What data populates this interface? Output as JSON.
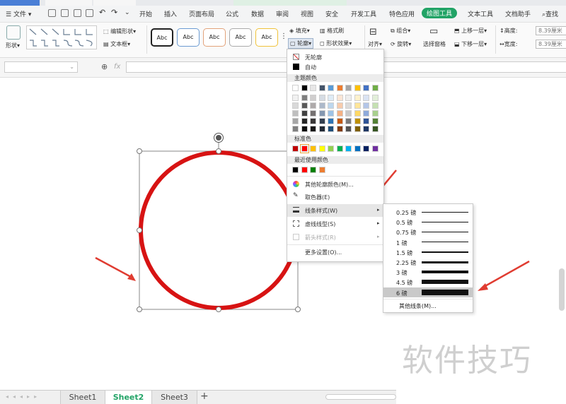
{
  "menu": {
    "file": "文件",
    "tabs": [
      "开始",
      "插入",
      "页面布局",
      "公式",
      "数据",
      "审阅",
      "视图",
      "安全",
      "开发工具",
      "特色应用",
      "绘图工具",
      "文本工具",
      "文档助手"
    ],
    "active_tab": "绘图工具",
    "search": "查找"
  },
  "ribbon": {
    "shape_label": "形状",
    "edit_shape": "编辑形状",
    "text_box": "文本框",
    "style_samples": [
      "Abc",
      "Abc",
      "Abc",
      "Abc",
      "Abc"
    ],
    "fill": "填充",
    "outline": "轮廓",
    "format_brush": "格式刷",
    "shape_effect": "形状效果",
    "align": "对齐",
    "group": "组合",
    "rotate": "旋转",
    "selection_pane": "选择窗格",
    "bring_forward": "上移一层",
    "send_backward": "下移一层",
    "height_label": "高度:",
    "width_label": "宽度:",
    "height_value": "8.39厘米",
    "width_value": "8.39厘米"
  },
  "formula": {
    "fx": "fx"
  },
  "outline_menu": {
    "no_outline": "无轮廓",
    "auto": "自动",
    "theme_colors_title": "主题颜色",
    "theme_top_row": [
      "#ffffff",
      "#000000",
      "#e7e6e6",
      "#44546a",
      "#5b9bd5",
      "#ed7d31",
      "#a5a5a5",
      "#ffc000",
      "#4472c4",
      "#70ad47"
    ],
    "theme_tint_columns": [
      [
        "#f2f2f2",
        "#d9d9d9",
        "#bfbfbf",
        "#a6a6a6",
        "#808080"
      ],
      [
        "#7f7f7f",
        "#595959",
        "#404040",
        "#262626",
        "#0d0d0d"
      ],
      [
        "#d0cece",
        "#aeaaaa",
        "#757171",
        "#3a3838",
        "#171616"
      ],
      [
        "#d6dce4",
        "#adb9ca",
        "#8497b0",
        "#333f4f",
        "#222a35"
      ],
      [
        "#deebf6",
        "#bdd7ee",
        "#9dc3e6",
        "#2e75b5",
        "#1f4e79"
      ],
      [
        "#fbe5d5",
        "#f7cbac",
        "#f4b183",
        "#c55a11",
        "#833c0b"
      ],
      [
        "#ededed",
        "#dbdbdb",
        "#c9c9c9",
        "#7b7b7b",
        "#525252"
      ],
      [
        "#fff2cc",
        "#fee599",
        "#ffd965",
        "#bf9000",
        "#7f6000"
      ],
      [
        "#dae3f3",
        "#b4c6e7",
        "#8eaadb",
        "#2f5496",
        "#1f3864"
      ],
      [
        "#e2efd9",
        "#c5e0b3",
        "#a8d08d",
        "#538135",
        "#375623"
      ]
    ],
    "standard_title": "标准色",
    "standard_colors": [
      "#c00000",
      "#ff0000",
      "#ffc000",
      "#ffff00",
      "#92d050",
      "#00b050",
      "#00b0f0",
      "#0070c0",
      "#002060",
      "#7030a0"
    ],
    "recent_title": "最近使用颜色",
    "recent_colors": [
      "#000000",
      "#ff0000",
      "#008000",
      "#ed7d31"
    ],
    "more_colors": "其他轮廓颜色(M)...",
    "eyedropper": "取色器(E)",
    "line_style": "线条样式(W)",
    "dash_type": "虚线线型(S)",
    "arrow_style": "箭头样式(R)",
    "more_settings": "更多设置(O)..."
  },
  "line_weights": {
    "items": [
      {
        "label": "0.25 磅",
        "pt": 0.25
      },
      {
        "label": "0.5 磅",
        "pt": 0.5
      },
      {
        "label": "0.75 磅",
        "pt": 0.75
      },
      {
        "label": "1 磅",
        "pt": 1
      },
      {
        "label": "1.5 磅",
        "pt": 1.5
      },
      {
        "label": "2.25 磅",
        "pt": 2.25
      },
      {
        "label": "3 磅",
        "pt": 3
      },
      {
        "label": "4.5 磅",
        "pt": 4.5
      },
      {
        "label": "6 磅",
        "pt": 6
      }
    ],
    "selected": "6 磅",
    "more": "其他线条(M)..."
  },
  "shape": {
    "outline_color": "#d71313"
  },
  "annotation_color": "#e03c31",
  "sheets": [
    "Sheet1",
    "Sheet2",
    "Sheet3"
  ],
  "active_sheet": "Sheet2",
  "add_sheet": "+",
  "watermark": "软件技巧"
}
